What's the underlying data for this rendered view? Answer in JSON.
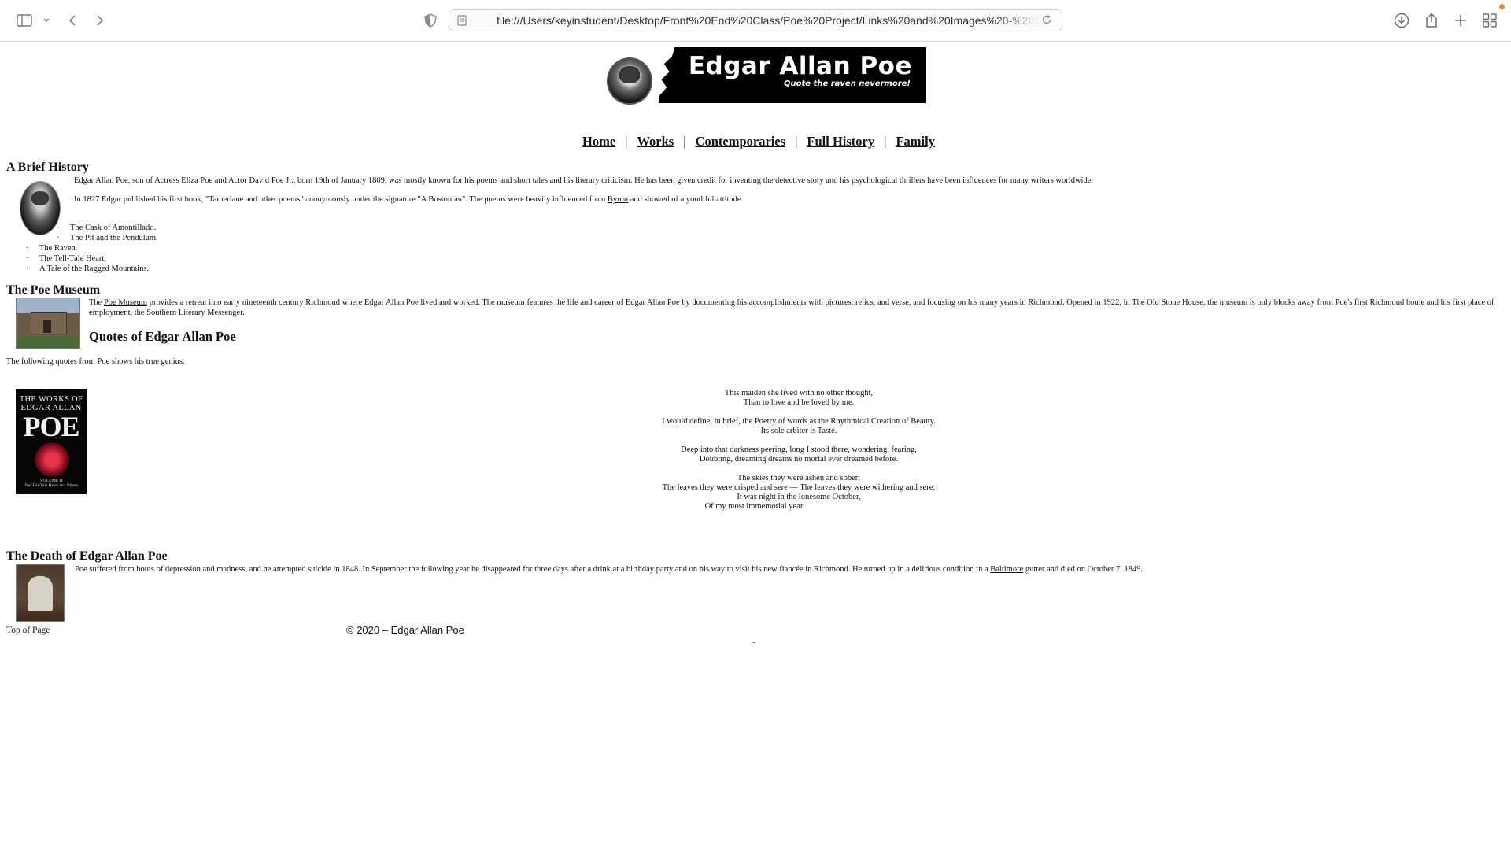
{
  "browser": {
    "url": "file:///Users/keyinstudent/Desktop/Front%20End%20Class/Poe%20Project/Links%20and%20Images%20-%201%..."
  },
  "banner": {
    "title": "Edgar Allan Poe",
    "tagline": "Quote the raven nevermore!"
  },
  "nav": {
    "items": [
      "Home",
      "Works",
      "Contemporaries",
      "Full History",
      "Family"
    ],
    "separator": "|"
  },
  "history": {
    "heading": "A Brief History",
    "para1": "Edgar Allan Poe, son of Actress Eliza Poe and Actor David Poe Jr., born 19th of January 1809, was mostly known for his poems and short tales and his literary criticism. He has been given credit for inventing the detective story and his psychological thrillers have been influences for many writers worldwide.",
    "para2_before": "In 1827 Edgar published his first book, \"Tamerlane and other poems\" anonymously under the signature \"A Bostonian\". The poems were heavily influenced from ",
    "para2_link": "Byron",
    "para2_after": " and showed of a youthful attitude.",
    "works_indented": [
      "The Cask of Amontillado.",
      "The Pit and the Pendulum."
    ],
    "works": [
      "The Raven.",
      "The Tell-Tale Heart.",
      "A Tale of the Ragged Mountains."
    ]
  },
  "museum": {
    "heading": "The Poe Museum",
    "text_before": "The ",
    "link": "Poe Museum",
    "text_after": " provides a retreat into early nineteenth century Richmond where Edgar Allan Poe lived and worked. The museum features the life and career of Edgar Allan Poe by documenting his accomplishments with pictures, relics, and verse, and focusing on his many years in Richmond. Opened in 1922, in The Old Stone House, the museum is only blocks away from Poe's first Richmond home and his first place of employment, the Southern Literary Messenger."
  },
  "quotes": {
    "heading": "Quotes of Edgar Allan Poe",
    "intro": "The following quotes from Poe shows his true genius.",
    "book": {
      "line1": "THE WORKS OF",
      "line2": "EDGAR ALLAN",
      "line3": "POE",
      "volume": "VOLUME II",
      "subtitle": "The Tell-Tale Heart and Others"
    },
    "q1": [
      "This maiden she lived with no other thought,",
      "Than to love and be loved by me."
    ],
    "q2": [
      "I would define, in brief, the Poetry of words as the Rhythmical Creation of Beauty.",
      "Its sole arbiter is Taste."
    ],
    "q3": [
      "Deep into that darkness peering, long I stood there, wondering, fearing,",
      "Doubting, dreaming dreams no mortal ever dreamed before."
    ],
    "q4": [
      "The skies they were ashen and sober;",
      "The leaves they were crisped and sere — The leaves they were withering and sere;",
      "It was night in the lonesome October,",
      "Of my most immemorial year."
    ]
  },
  "death": {
    "heading": "The Death of Edgar Allan Poe",
    "text_before": "Poe suffered from bouts of depression and madness, and he attempted suicide in 1848. In September the following year he disappeared for three days after a drink at a birthday party and on his way to visit his new fiancée in Richmond. He turned up in a delirious condition in a ",
    "link": "Baltimore",
    "text_after": " gutter and died on October 7, 1849."
  },
  "footer": {
    "top_link": "Top of Page",
    "copyright": "© 2020 – Edgar Allan Poe",
    "dash": "-"
  }
}
